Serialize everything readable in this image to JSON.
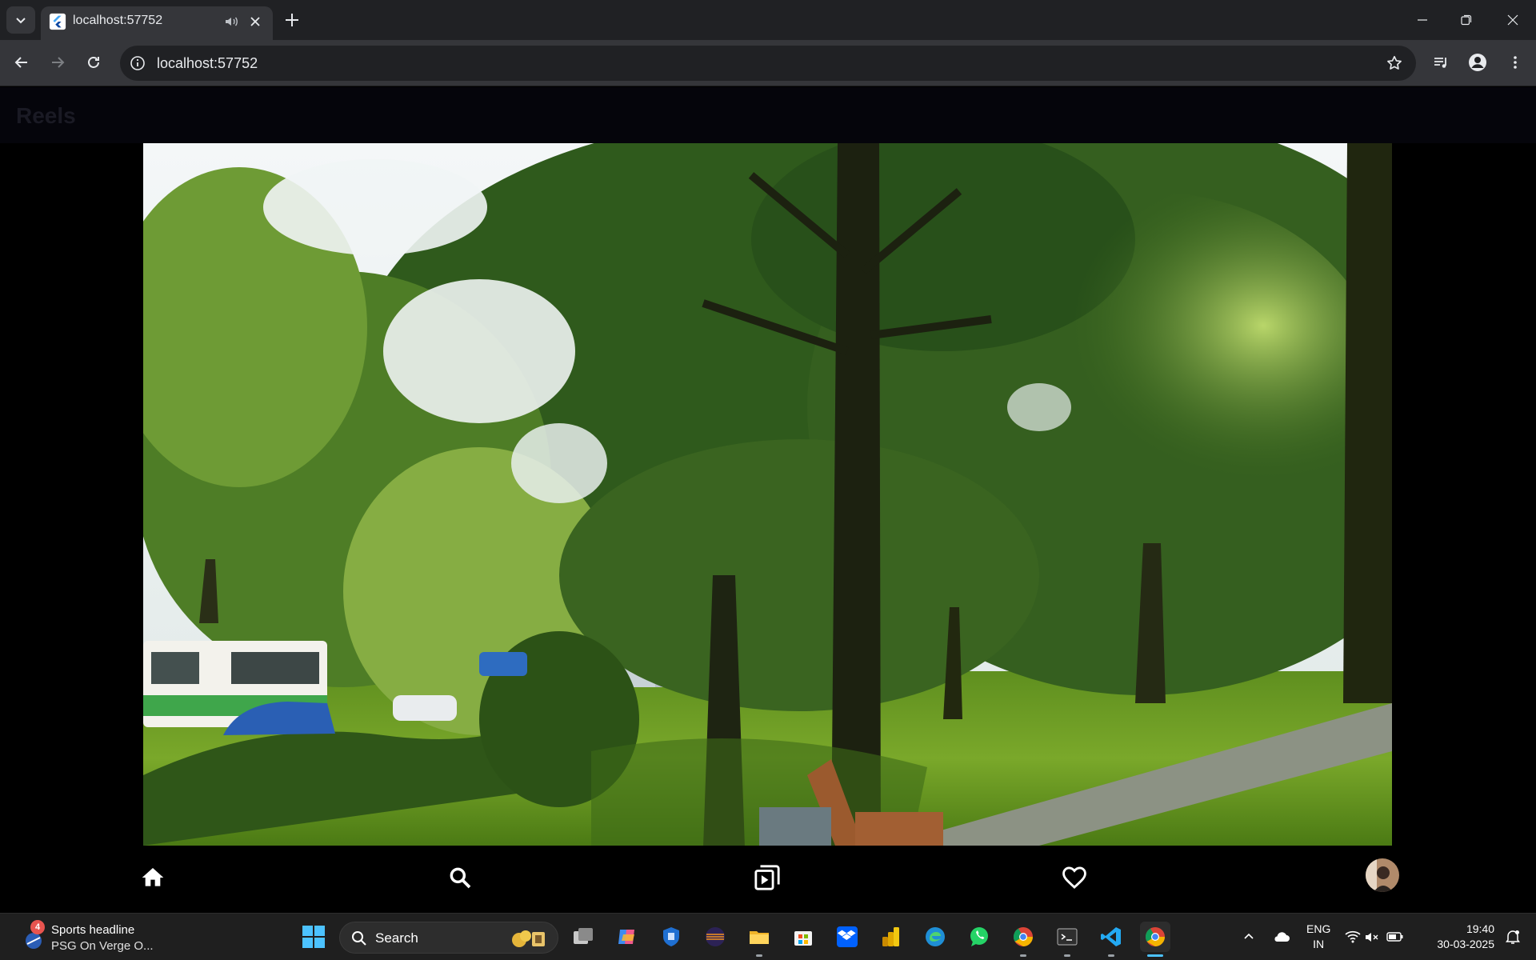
{
  "browser": {
    "tab_title": "localhost:57752",
    "url": "localhost:57752"
  },
  "app": {
    "title": "Reels",
    "bottom_nav": [
      "home-icon",
      "search-icon",
      "reels-icon",
      "heart-icon",
      "avatar"
    ]
  },
  "taskbar": {
    "widget_title": "Sports headline",
    "widget_subtitle": "PSG On Verge O...",
    "widget_badge": "4",
    "search_label": "Search",
    "lang_line1": "ENG",
    "lang_line2": "IN",
    "time": "19:40",
    "date": "30-03-2025"
  },
  "colors": {
    "accent": "#4cc2ff",
    "tab_bg": "#35363a",
    "chrome_bg": "#202124"
  }
}
